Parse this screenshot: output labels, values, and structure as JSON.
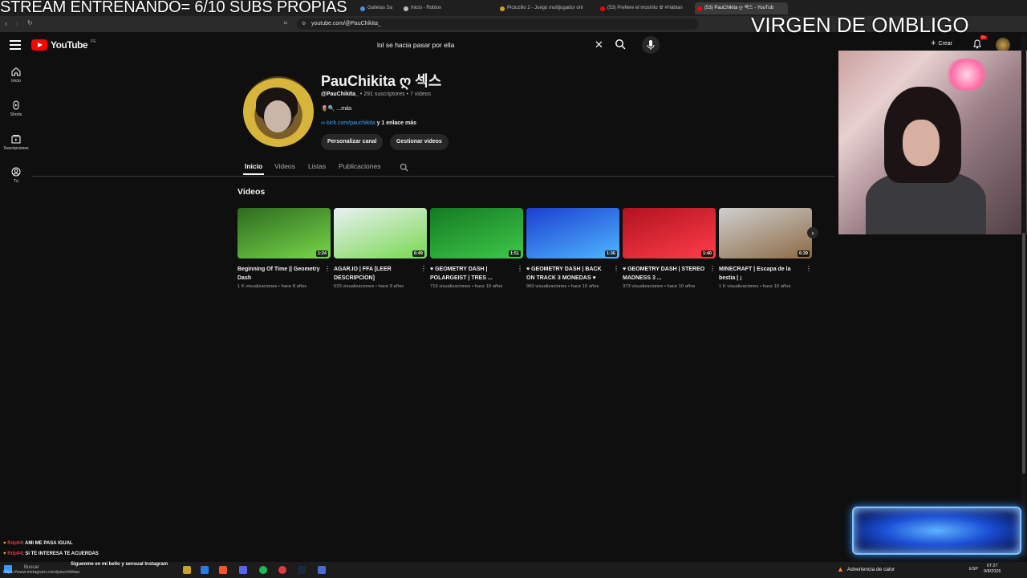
{
  "stream_overlay": {
    "title": "STREAM ENTRENANDO= 6/10 SUBS PROPIAS",
    "right_text": "VIRGEN DE OMBLIGO"
  },
  "browser": {
    "tabs": [
      {
        "label": "Galletas Sa",
        "color": "#4a90e2"
      },
      {
        "label": "Inicio - Roblox",
        "color": "#bbbbbb"
      },
      {
        "label": "Pictuzillo 2 - Juego multijugador onl",
        "color": "#c9a227"
      },
      {
        "label": "(53) Prefiere el mostrito ☢ #Hablan",
        "color": "#ff0000"
      },
      {
        "label": "(53) PauChikita ღ 섹스 - YouTub",
        "color": "#ff0000",
        "active": true
      }
    ],
    "url": "youtube.com/@PauChikita_"
  },
  "youtube": {
    "logo_text": "YouTube",
    "region": "PE",
    "search_query": "lol se hacia pasar por ella",
    "create_label": "Crear",
    "notification_count": "9+",
    "sidebar": [
      {
        "label": "Inicio",
        "icon": "home-icon"
      },
      {
        "label": "Shorts",
        "icon": "shorts-icon"
      },
      {
        "label": "Suscripciones",
        "icon": "subscriptions-icon"
      },
      {
        "label": "Tú",
        "icon": "you-icon"
      }
    ]
  },
  "channel": {
    "name": "PauChikita ღ 섹스",
    "handle": "@PauChikita_",
    "stats": " • 291 suscriptores • 7 videos",
    "description": "🌷🔍 ...más",
    "link": "kick.com/pauchikita",
    "link_more": " y 1 enlace más",
    "buttons": {
      "customize": "Personalizar canal",
      "manage": "Gestionar videos"
    },
    "tabs": [
      "Inicio",
      "Videos",
      "Listas",
      "Publicaciones"
    ],
    "section_heading": "Videos"
  },
  "videos": [
    {
      "title": "Beginning Of Time || Geometry Dash",
      "meta": "1 K visualizaciones • hace 8 años",
      "duration": "1:24",
      "colors": [
        "#2d6b1f",
        "#78d64a"
      ]
    },
    {
      "title": "AGAR.IO | FFA [LEER DESCRIPCION]",
      "meta": "533 visualizaciones • hace 9 años",
      "duration": "6:49",
      "colors": [
        "#e9f1f3",
        "#78d850"
      ]
    },
    {
      "title": "♥ GEOMETRY DASH | POLARGEIST | TRES ...",
      "meta": "716 visualizaciones • hace 10 años",
      "duration": "1:51",
      "colors": [
        "#147a22",
        "#3fc84a"
      ]
    },
    {
      "title": "♥ GEOMETRY DASH | BACK ON TRACK 3 MONEDAS ♥",
      "meta": "960 visualizaciones • hace 10 años",
      "duration": "1:36",
      "colors": [
        "#1b3fd0",
        "#4fb6ff"
      ]
    },
    {
      "title": "♥ GEOMETRY DASH | STEREO MADNESS 3 ...",
      "meta": "373 visualizaciones • hace 10 años",
      "duration": "1:40",
      "colors": [
        "#b1121f",
        "#ff3d4a"
      ]
    },
    {
      "title": "MINECRAFT | Escapa de la bestia | ¡",
      "meta": "1 K visualizaciones • hace 10 años",
      "duration": "6:39",
      "colors": [
        "#cfcfcf",
        "#8c6a44"
      ]
    }
  ],
  "chat": [
    {
      "user": "Rdp94",
      "message": ": AMI ME PASA IGUAL"
    },
    {
      "user": "Rdp94",
      "message": ": SI TE INTERESA TE ACUERDAS"
    },
    {
      "user": "",
      "message": "Siguenme en mi bello y sensual Instagram"
    }
  ],
  "instagram_url": "https://www.instagram.com/pauchikitaa",
  "taskbar": {
    "search_label": "Buscar",
    "weather": "Advertencia de calor",
    "lang": "ESP",
    "time": "07:27",
    "date": "9/8/2026"
  }
}
